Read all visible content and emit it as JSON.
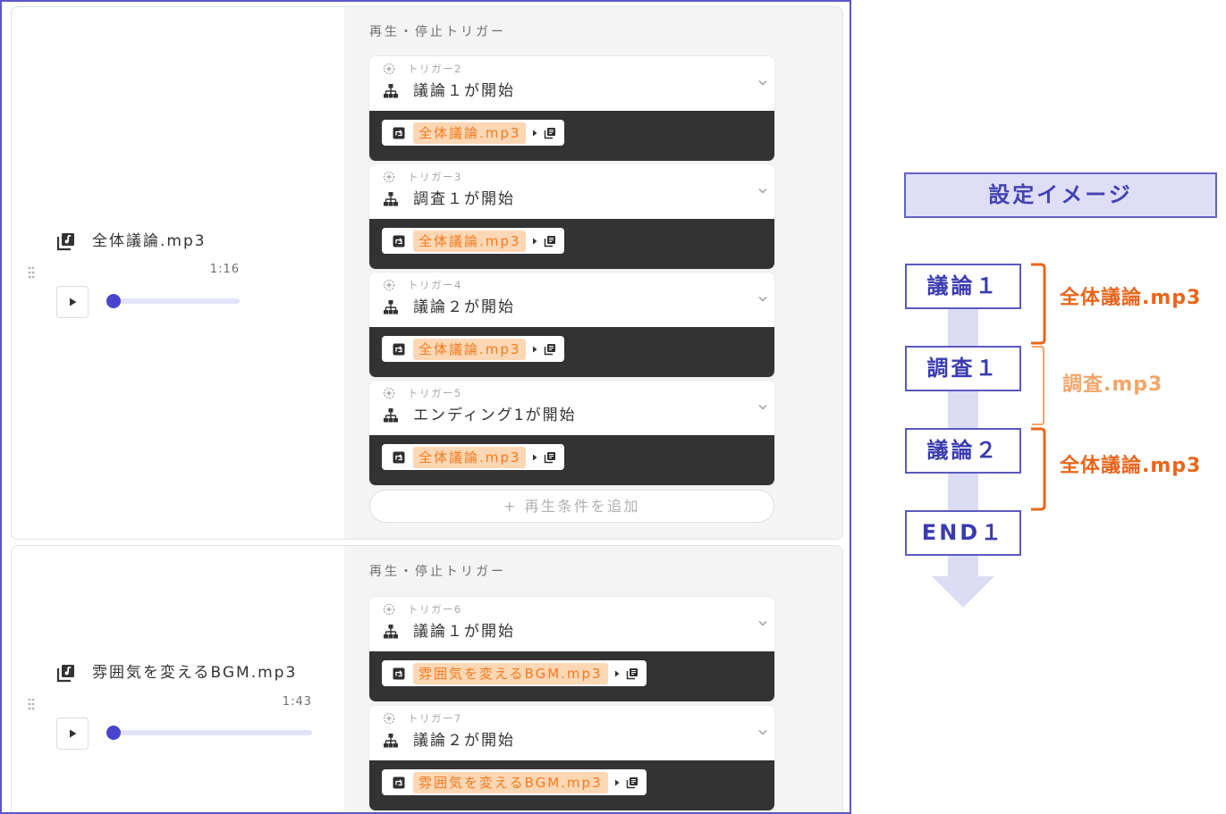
{
  "left_panel": {
    "cards": [
      {
        "track": {
          "icon": "music-library-icon",
          "name": "全体議論.mp3",
          "duration": "1:16",
          "progress": 0
        },
        "triggers_label": "再生・停止トリガー",
        "triggers": [
          {
            "label": "トリガー2",
            "condition": "議論１が開始",
            "track": "全体議論.mp3"
          },
          {
            "label": "トリガー3",
            "condition": "調査１が開始",
            "track": "全体議論.mp3"
          },
          {
            "label": "トリガー4",
            "condition": "議論２が開始",
            "track": "全体議論.mp3"
          },
          {
            "label": "トリガー5",
            "condition": "エンディング1が開始",
            "track": "全体議論.mp3"
          }
        ],
        "add_condition_label": "+ 再生条件を追加"
      },
      {
        "track": {
          "icon": "music-library-icon",
          "name": "雰囲気を変えるBGM.mp3",
          "duration": "1:43",
          "progress": 0
        },
        "triggers_label": "再生・停止トリガー",
        "triggers": [
          {
            "label": "トリガー6",
            "condition": "議論１が開始",
            "track": "雰囲気を変えるBGM.mp3"
          },
          {
            "label": "トリガー7",
            "condition": "議論２が開始",
            "track": "雰囲気を変えるBGM.mp3"
          }
        ]
      }
    ]
  },
  "diagram": {
    "title": "設定イメージ",
    "steps": [
      "議論１",
      "調査１",
      "議論２",
      "END１"
    ],
    "annotations": [
      {
        "text": "全体議論.mp3",
        "color": "#e8661a"
      },
      {
        "text": "調査.mp3",
        "color": "#f3a66b"
      },
      {
        "text": "全体議論.mp3",
        "color": "#e8661a"
      }
    ]
  },
  "colors": {
    "frame_border": "#5c56c9",
    "accent": "#4944cf",
    "track_highlight_text": "#f47a1f",
    "track_highlight_bg": "#fcd7b4",
    "action_bar_bg": "#333333",
    "diagram_fill": "#dedef7",
    "diagram_text": "#3b3bb0"
  }
}
